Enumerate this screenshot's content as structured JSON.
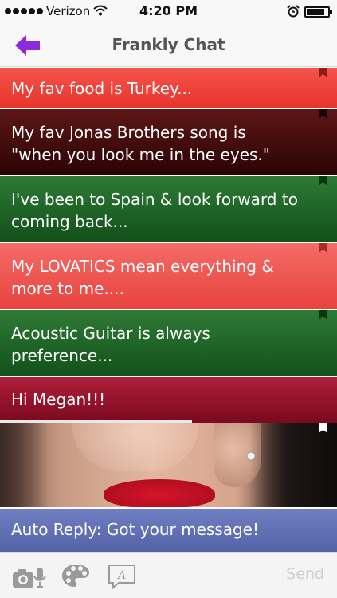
{
  "status_bar": {
    "carrier": "Verizon",
    "time": "4:20 PM",
    "battery_level": 0.85
  },
  "nav": {
    "title": "Frankly Chat",
    "back_icon": "back-arrow-icon",
    "accent_color": "#8a2be2"
  },
  "messages": [
    {
      "text": "My fav food is Turkey...",
      "color": "#e8342d"
    },
    {
      "text": "My fav Jonas Brothers song is\n\"when you look me in the eyes.\"",
      "color": "#3a0808"
    },
    {
      "text": "I've been to Spain & look forward to\ncoming back...",
      "color": "#1b5e22"
    },
    {
      "text": "My LOVATICS mean everything &\nmore to me....",
      "color": "#ef5550"
    },
    {
      "text": "Acoustic Guitar is always\npreference...",
      "color": "#1b5e22"
    },
    {
      "text": "Hi Megan!!!",
      "color": "#9a1530"
    }
  ],
  "playback_progress": 0.57,
  "auto_reply": "Auto Reply: Got your message!",
  "toolbar": {
    "send_label": "Send",
    "icons": [
      "camera-mic-icon",
      "palette-icon",
      "text-style-icon"
    ]
  }
}
